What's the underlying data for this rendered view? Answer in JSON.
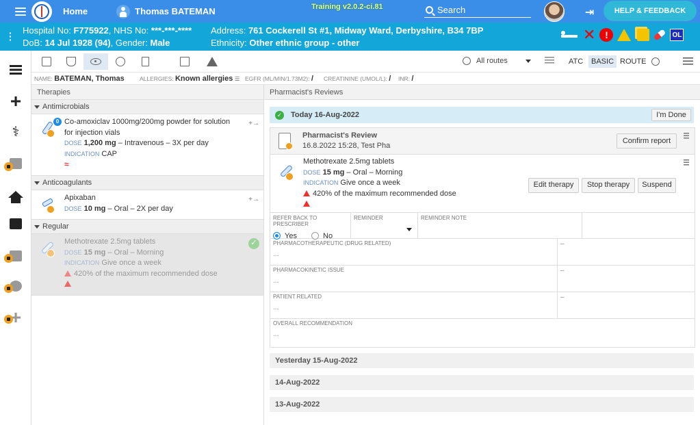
{
  "topbar": {
    "home_label": "Home",
    "patient_name": "Thomas BATEMAN",
    "version": "Training v2.0.2-ci.81",
    "search_placeholder": "Search",
    "help_label": "HELP & FEEDBACK"
  },
  "banner": {
    "hospital_no_label": "Hospital No:",
    "hospital_no": "F775922",
    "nhs_no_label": "NHS No:",
    "nhs_no": "***-***-****",
    "dob_label": "DoB:",
    "dob": "14 Jul 1928 (94)",
    "gender_label": "Gender:",
    "gender": "Male",
    "address_label": "Address:",
    "address": "761 Cockerell St #1, Midway Ward, Derbyshire, B34 7BP",
    "ethnicity_label": "Ethnicity:",
    "ethnicity": "Other ethnic group - other",
    "ol_badge": "OL",
    "excl": "!"
  },
  "toolbar": {
    "routes_label": "All routes",
    "views": [
      "ATC",
      "BASIC",
      "ROUTE"
    ]
  },
  "infobar": {
    "name_label": "NAME:",
    "name": "BATEMAN, Thomas",
    "allergies_label": "ALLERGIES:",
    "allergies": "Known allergies",
    "egfr_label": "EGFR (ML/MIN/1.73M2):",
    "egfr": "/",
    "creat_label": "CREATININE (UMOL/L):",
    "creat": "/",
    "inr_label": "INR:",
    "inr": "/"
  },
  "therapies": {
    "title": "Therapies",
    "groups": [
      {
        "name": "Antimicrobials",
        "items": [
          {
            "name_line1": "Co-amoxiclav 1000mg/200mg powder for solution",
            "name_line2": "for injection vials",
            "dose_label": "DOSE",
            "dose": "1,200 mg",
            "dose_rest": "– Intravenous – 3X per day",
            "indication_label": "INDICATION",
            "indication": "CAP",
            "count_badge": "0"
          }
        ]
      },
      {
        "name": "Anticoagulants",
        "items": [
          {
            "name_line1": "Apixaban",
            "dose_label": "DOSE",
            "dose": "10 mg",
            "dose_rest": "– Oral – 2X per day"
          }
        ]
      },
      {
        "name": "Regular",
        "items": [
          {
            "name_line1": "Methotrexate 2.5mg tablets",
            "dose_label": "DOSE",
            "dose": "15 mg",
            "dose_rest": "– Oral – Morning",
            "indication_label": "INDICATION",
            "indication": "Give once a week",
            "warning": "420% of the maximum recommended dose"
          }
        ]
      }
    ]
  },
  "reviews": {
    "title": "Pharmacist's Reviews",
    "today_label": "Today 16-Aug-2022",
    "done_button": "I'm Done",
    "review": {
      "title": "Pharmacist's Review",
      "subtitle": "16.8.2022 15:28, Test Pha",
      "confirm_button": "Confirm report",
      "med_name": "Methotrexate 2.5mg tablets",
      "dose_label": "DOSE",
      "dose": "15 mg",
      "dose_rest": "– Oral – Morning",
      "indication_label": "INDICATION",
      "indication": "Give once a week",
      "warning": "420% of the maximum recommended dose",
      "edit_button": "Edit therapy",
      "stop_button": "Stop therapy",
      "suspend_button": "Suspend",
      "refer_label": "REFER BACK TO PRESCRIBER",
      "yes_label": "Yes",
      "no_label": "No",
      "reminder_label": "REMINDER",
      "reminder_note_label": "REMINDER NOTE",
      "pharmacotherapeutic_label": "PHARMACOTHERAPEUTIC (DRUG RELATED)",
      "pharmacokinetic_label": "PHARMACOKINETIC ISSUE",
      "patient_related_label": "PATIENT RELATED",
      "overall_label": "OVERALL RECOMMENDATION",
      "empty_value": "...",
      "dash": "–"
    },
    "past_days": [
      "Yesterday 15-Aug-2022",
      "14-Aug-2022",
      "13-Aug-2022"
    ]
  }
}
